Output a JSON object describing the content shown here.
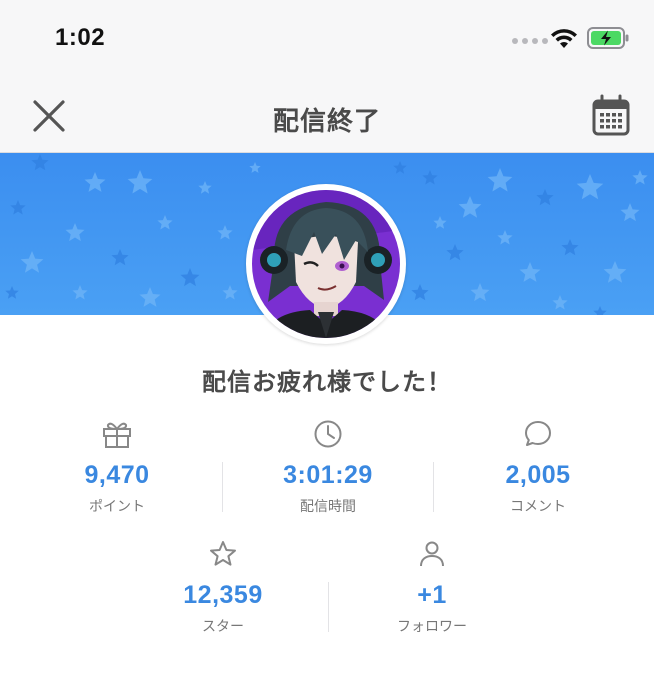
{
  "status_bar": {
    "time": "1:02"
  },
  "nav": {
    "title": "配信終了"
  },
  "message": "配信お疲れ様でした！",
  "stats_row1": [
    {
      "value": "9,470",
      "label": "ポイント",
      "icon": "gift-icon"
    },
    {
      "value": "3:01:29",
      "label": "配信時間",
      "icon": "clock-icon"
    },
    {
      "value": "2,005",
      "label": "コメント",
      "icon": "comment-icon"
    }
  ],
  "stats_row2": [
    {
      "value": "12,359",
      "label": "スター",
      "icon": "star-icon"
    },
    {
      "value": "+1",
      "label": "フォロワー",
      "icon": "person-icon"
    }
  ],
  "colors": {
    "accent": "#3a88e0",
    "banner": "#3b8ef0",
    "battery": "#4cd964"
  }
}
